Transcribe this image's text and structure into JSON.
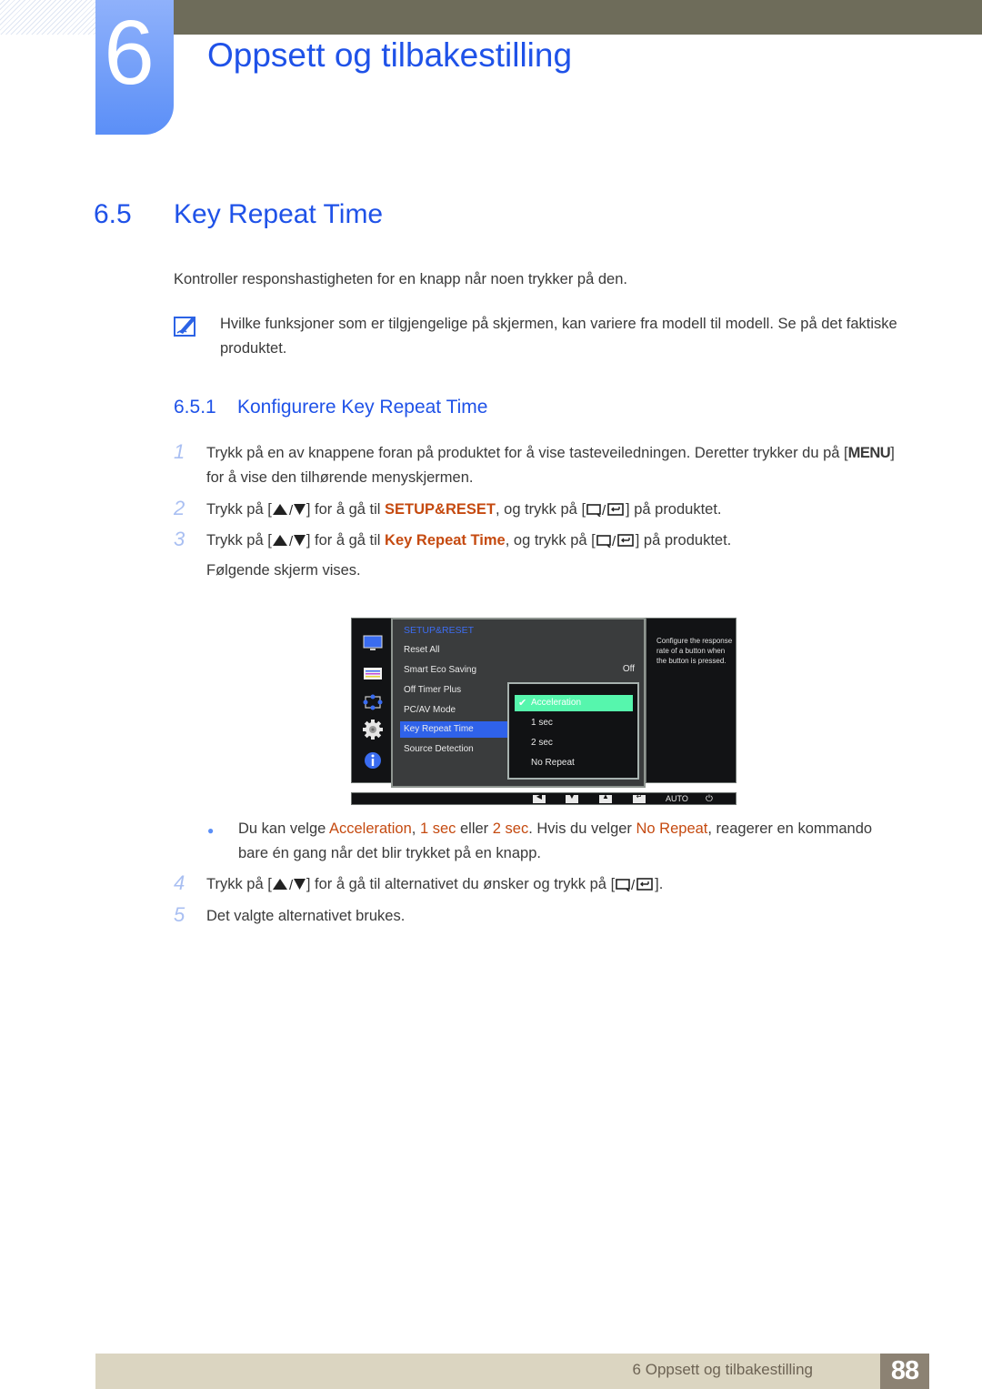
{
  "chapter": {
    "number": "6",
    "title": "Oppsett og tilbakestilling"
  },
  "section": {
    "number": "6.5",
    "title": "Key Repeat Time",
    "intro": "Kontroller responshastigheten for en knapp når noen trykker på den.",
    "note": "Hvilke funksjoner som er tilgjengelige på skjermen, kan variere fra modell til modell. Se på det faktiske produktet."
  },
  "subsection": {
    "number": "6.5.1",
    "title": "Konfigurere Key Repeat Time"
  },
  "steps": [
    {
      "num": "1",
      "a": "Trykk på en av knappene foran på produktet for å vise tasteveiledningen. Deretter trykker du på [",
      "key": "MENU",
      "b": "] for å vise den tilhørende menyskjermen."
    },
    {
      "num": "2",
      "a": "Trykk på [",
      "b": "] for å gå til ",
      "hl": "SETUP&RESET",
      "c": ", og trykk på [",
      "d": "] på produktet."
    },
    {
      "num": "3",
      "a": "Trykk på [",
      "b": "] for å gå til ",
      "hl": "Key Repeat Time",
      "c": ", og trykk på [",
      "d": "] på produktet.",
      "after": "Følgende skjerm vises."
    },
    {
      "num": "4",
      "a": "Trykk på [",
      "b": "] for å gå til alternativet du ønsker og trykk på [",
      "c": "]."
    },
    {
      "num": "5",
      "a": "Det valgte alternativet brukes."
    }
  ],
  "bullet": {
    "a": "Du kan velge ",
    "opt1": "Acceleration",
    "sep1": ", ",
    "opt2": "1 sec",
    "sep2": " eller ",
    "opt3": "2 sec",
    "b": ". Hvis du velger ",
    "opt4": "No Repeat",
    "c": ", reagerer en kommando bare én gang når det blir trykket på en knapp."
  },
  "osd": {
    "header": "SETUP&RESET",
    "menu": [
      "Reset All",
      "Smart Eco Saving",
      "Off Timer Plus",
      "PC/AV Mode",
      "Key Repeat Time",
      "Source Detection"
    ],
    "selected_menu": "Key Repeat Time",
    "smart_eco_value": "Off",
    "options": [
      "Acceleration",
      "1 sec",
      "2 sec",
      "No Repeat"
    ],
    "selected_option": "Acceleration",
    "help": "Configure the response rate of a button when the button is pressed.",
    "keys": {
      "left": "◀",
      "down": "▼",
      "up": "▲",
      "enter": "↵",
      "auto": "AUTO",
      "power": "⏻"
    },
    "side_icons": [
      "monitor-icon",
      "picture-settings-icon",
      "position-icon",
      "gear-icon",
      "info-icon"
    ]
  },
  "footer": {
    "label": "6 Oppsett og tilbakestilling",
    "page": "88"
  },
  "colors": {
    "heading_blue": "#1f52e8",
    "highlight": "#c54a10",
    "osd_selected": "#2f62ea",
    "osd_option_selected": "#56f6ad"
  }
}
